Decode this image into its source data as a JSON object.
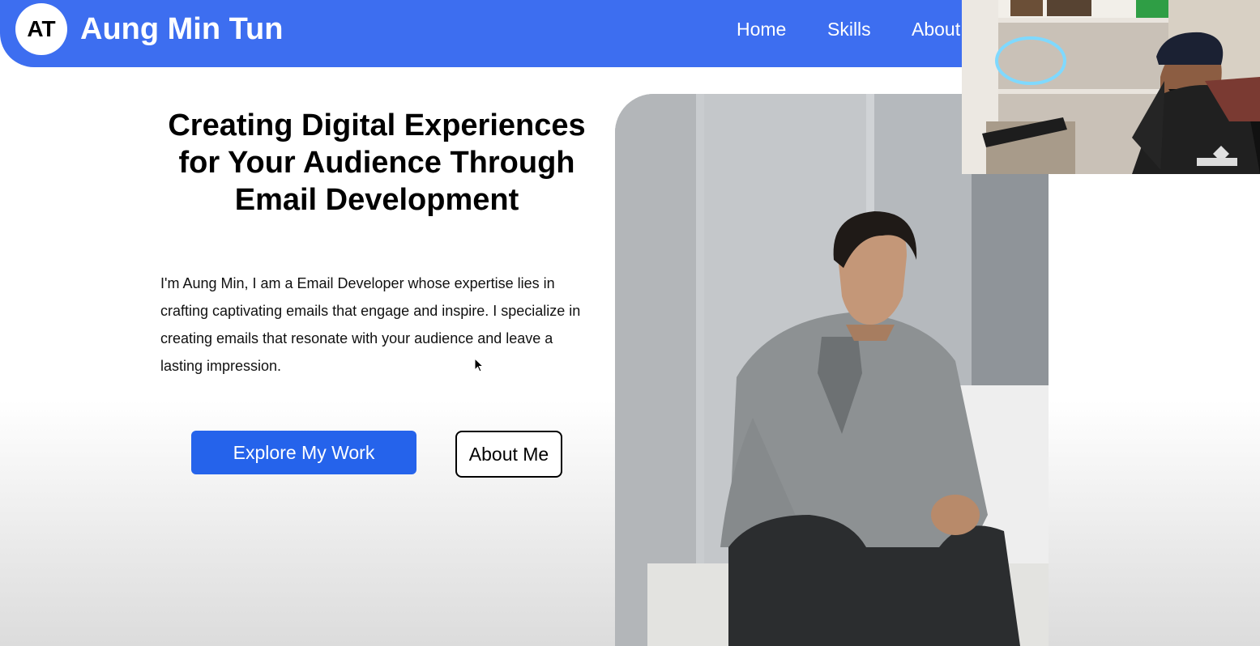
{
  "header": {
    "logo_initials": "AT",
    "brand_name": "Aung Min Tun",
    "nav": {
      "home": "Home",
      "skills": "Skills",
      "about": "About"
    }
  },
  "hero": {
    "title": "Creating Digital Experiences for Your Audience Through Email Development",
    "description": "I'm Aung Min, I am a Email Developer whose expertise lies in crafting captivating emails that engage and inspire. I specialize in creating emails that resonate with your audience and leave a lasting impression.",
    "primary_button": "Explore My Work",
    "secondary_button": "About Me"
  },
  "colors": {
    "header_blue": "#3d6ef0",
    "button_blue": "#2563eb"
  },
  "icons": {
    "cursor": "mouse-pointer-icon"
  }
}
